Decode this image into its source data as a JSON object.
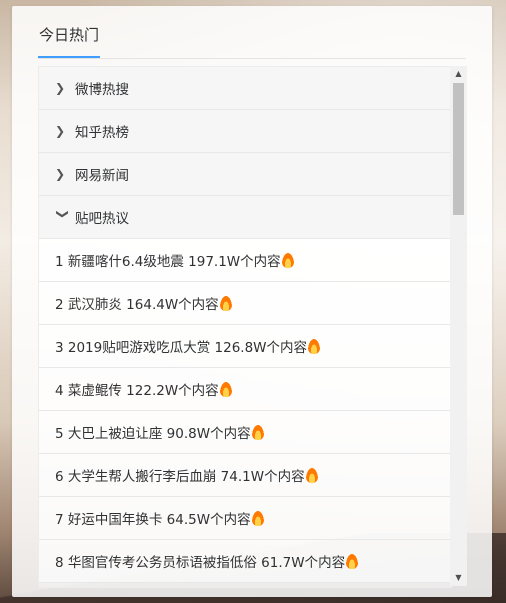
{
  "tab": {
    "label": "今日热门"
  },
  "sections": [
    {
      "label": "微博热搜",
      "expanded": false
    },
    {
      "label": "知乎热榜",
      "expanded": false
    },
    {
      "label": "网易新闻",
      "expanded": false
    },
    {
      "label": "贴吧热议",
      "expanded": true
    }
  ],
  "items": [
    {
      "text": "1 新疆喀什6.4级地震 197.1W个内容"
    },
    {
      "text": "2 武汉肺炎 164.4W个内容"
    },
    {
      "text": "3 2019贴吧游戏吃瓜大赏 126.8W个内容"
    },
    {
      "text": "4 菜虚鲲传 122.2W个内容"
    },
    {
      "text": "5 大巴上被迫让座 90.8W个内容"
    },
    {
      "text": "6 大学生帮人搬行李后血崩 74.1W个内容"
    },
    {
      "text": "7 好运中国年换卡 64.5W个内容"
    },
    {
      "text": "8 华图官传考公务员标语被指低俗 61.7W个内容"
    }
  ],
  "icons": {
    "collapsed": "chevron-right-icon",
    "expanded": "chevron-down-icon",
    "hot": "fire-icon"
  },
  "colors": {
    "tab_underline": "#409eff",
    "text": "#303133",
    "fire": "#ff7a00"
  }
}
